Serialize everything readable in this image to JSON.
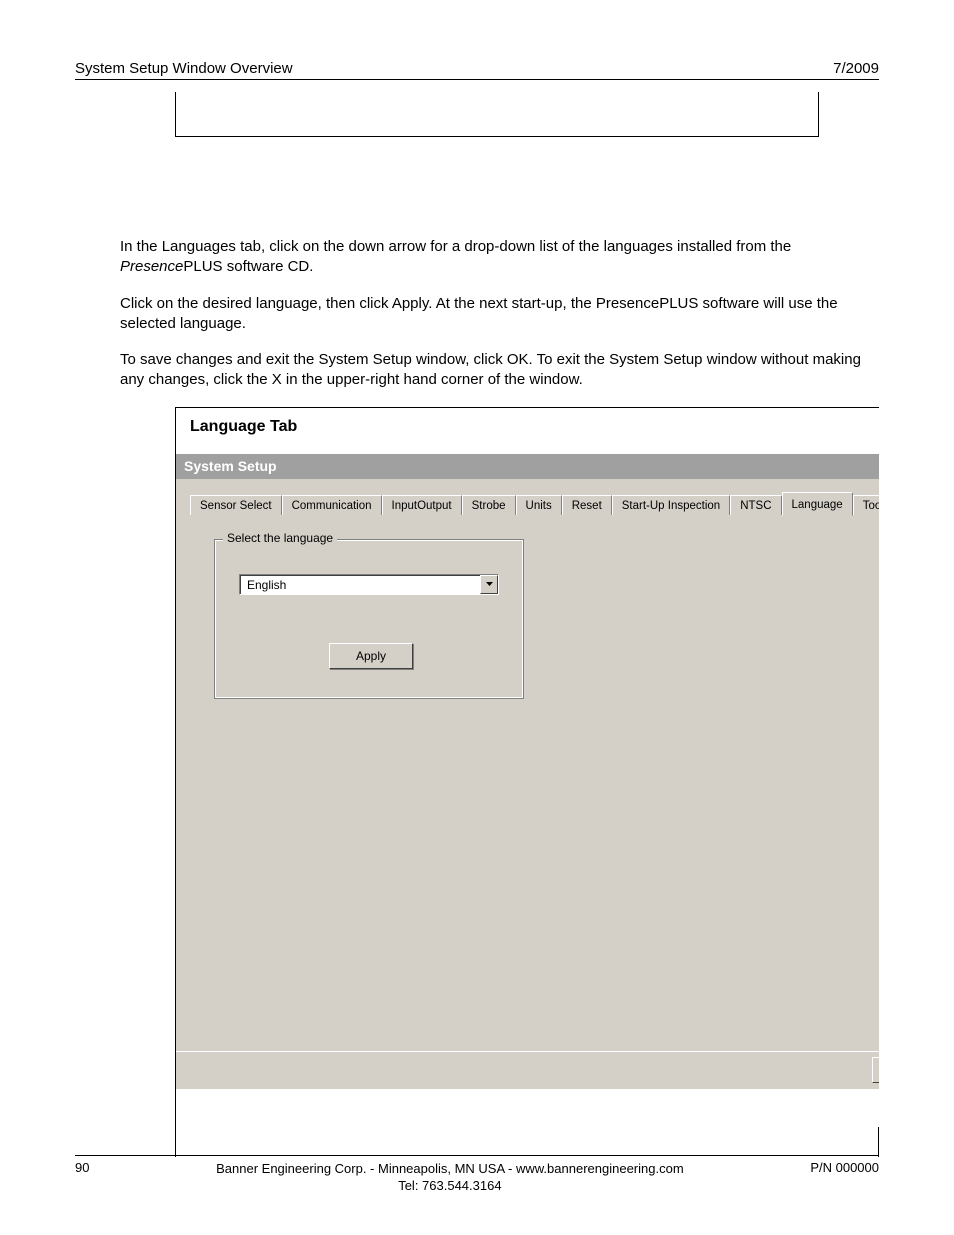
{
  "header": {
    "left": "System Setup Window Overview",
    "right": "7/2009"
  },
  "paragraphs": {
    "p1_a": "In the Languages tab, click on the down arrow for a drop-down list of the languages installed from the ",
    "p1_italic": "Presence",
    "p1_b": "PLUS software CD.",
    "p2": "Click on the desired language, then click Apply. At the next start-up, the PresencePLUS software will use the selected language.",
    "p3": "To save changes and exit the System Setup window, click OK. To exit the System Setup window without making any changes, click the X in the upper-right hand corner of the window."
  },
  "figure": {
    "title": "Language Tab",
    "window_title": "System Setup",
    "tabs": [
      "Sensor Select",
      "Communication",
      "InputOutput",
      "Strobe",
      "Units",
      "Reset",
      "Start-Up Inspection",
      "NTSC",
      "Language",
      "Tools Configurat"
    ],
    "active_tab_index": 8,
    "groupbox_label": "Select the language",
    "dropdown_value": "English",
    "apply_label": "Apply"
  },
  "footer": {
    "page_number": "90",
    "center_line1": "Banner Engineering Corp. - Minneapolis, MN USA - www.bannerengineering.com",
    "center_line2": "Tel: 763.544.3164",
    "right": "P/N 000000"
  }
}
